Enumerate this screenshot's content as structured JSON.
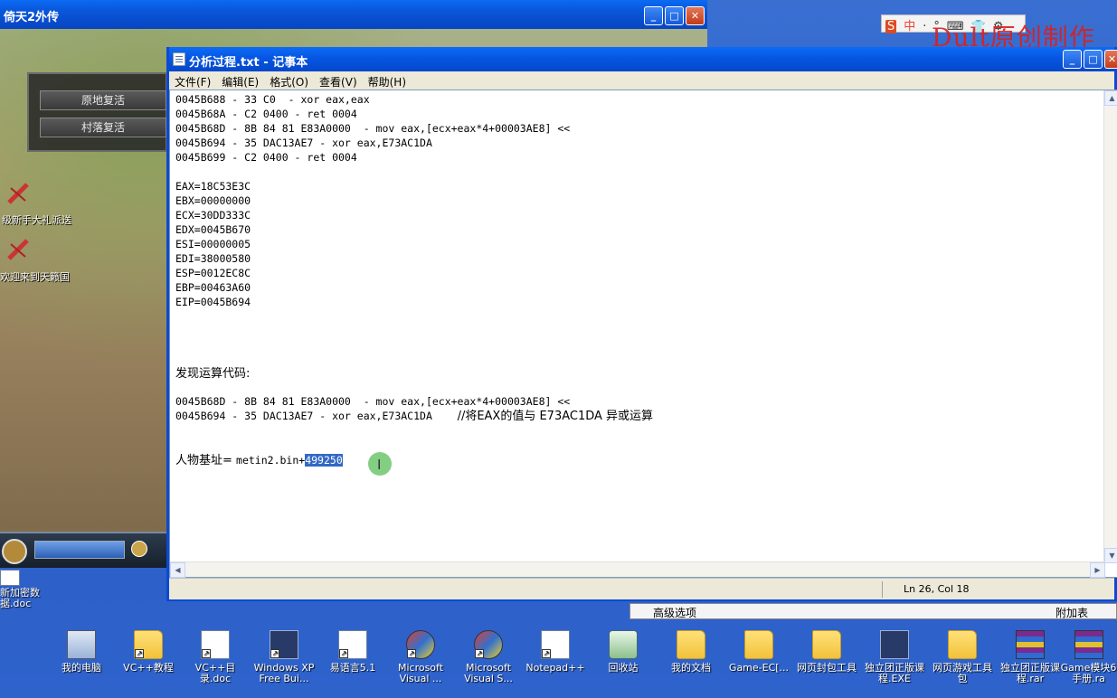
{
  "game_window": {
    "title": "倚天2外传",
    "buttons": [
      "原地复活",
      "村落复活"
    ],
    "side_texts": [
      "级新手大礼派送",
      "欢迎来到天籁国"
    ]
  },
  "notepad": {
    "title": "分析过程.txt - 记事本",
    "menu": [
      "文件(F)",
      "编辑(E)",
      "格式(O)",
      "查看(V)",
      "帮助(H)"
    ],
    "lines": {
      "l1": "0045B688 - 33 C0  - xor eax,eax",
      "l2": "0045B68A - C2 0400 - ret 0004",
      "l3": "0045B68D - 8B 84 81 E83A0000  - mov eax,[ecx+eax*4+00003AE8] <<",
      "l4": "0045B694 - 35 DAC13AE7 - xor eax,E73AC1DA",
      "l5": "0045B699 - C2 0400 - ret 0004",
      "r1": "EAX=18C53E3C",
      "r2": "EBX=00000000",
      "r3": "ECX=30DD333C",
      "r4": "EDX=0045B670",
      "r5": "ESI=00000005",
      "r6": "EDI=38000580",
      "r7": "ESP=0012EC8C",
      "r8": "EBP=00463A60",
      "r9": "EIP=0045B694",
      "found": "发现运算代码:",
      "c1": "0045B68D - 8B 84 81 E83A0000  - mov eax,[ecx+eax*4+00003AE8] <<",
      "c2a": "0045B694 - 35 DAC13AE7 - xor eax,E73AC1DA    ",
      "c2b": "//将EAX的值与 E73AC1DA 异或运算",
      "base_label": "人物基址= ",
      "base_module": "metin2.bin+",
      "base_offset": "499250"
    },
    "status": "Ln 26, Col 18"
  },
  "bottom_strip": {
    "left": "高级选项",
    "right": "附加表"
  },
  "ime_bar": [
    "S",
    "中",
    "·",
    "°",
    "⌨",
    "👕",
    "⚙"
  ],
  "watermark": "Dult原创制作",
  "desktop_icons": [
    {
      "label": "我的电脑",
      "type": "pc"
    },
    {
      "label": "VC++教程",
      "type": "folder"
    },
    {
      "label": "VC++目录.doc",
      "type": "doc"
    },
    {
      "label": "Windows XP Free Bui...",
      "type": "exe"
    },
    {
      "label": "易语言5.1",
      "type": "doc"
    },
    {
      "label": "Microsoft Visual ...",
      "type": "bow"
    },
    {
      "label": "Microsoft Visual S...",
      "type": "bow"
    },
    {
      "label": "Notepad++",
      "type": "doc"
    },
    {
      "label": "回收站",
      "type": "bin"
    },
    {
      "label": "我的文档",
      "type": "folder"
    },
    {
      "label": "Game-EC[...",
      "type": "folder"
    },
    {
      "label": "网页封包工具",
      "type": "folder"
    },
    {
      "label": "独立团正版课程.EXE",
      "type": "exe"
    },
    {
      "label": "网页游戏工具包",
      "type": "folder"
    },
    {
      "label": "独立团正版课程.rar",
      "type": "rar"
    },
    {
      "label": "Game模块6手册.ra",
      "type": "rar"
    }
  ],
  "left_desktop_icon": {
    "label": "新加密数据.doc"
  }
}
